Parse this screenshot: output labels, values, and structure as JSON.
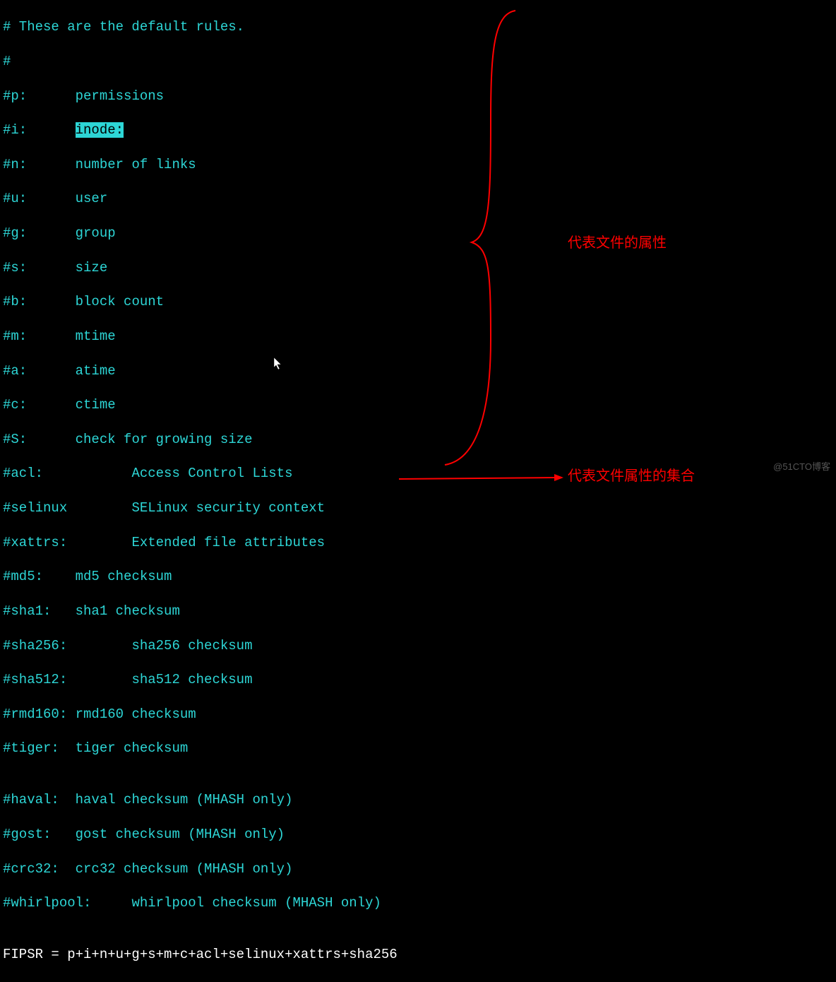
{
  "terminal": {
    "lines": [
      {
        "text": "# These are the default rules."
      },
      {
        "text": "#"
      },
      {
        "prefix": "#p:      ",
        "value": "permissions"
      },
      {
        "prefix": "#i:      ",
        "highlight": "inode:"
      },
      {
        "prefix": "#n:      ",
        "value": "number of links"
      },
      {
        "prefix": "#u:      ",
        "value": "user"
      },
      {
        "prefix": "#g:      ",
        "value": "group"
      },
      {
        "prefix": "#s:      ",
        "value": "size"
      },
      {
        "prefix": "#b:      ",
        "value": "block count"
      },
      {
        "prefix": "#m:      ",
        "value": "mtime"
      },
      {
        "prefix": "#a:      ",
        "value": "atime"
      },
      {
        "prefix": "#c:      ",
        "value": "ctime"
      },
      {
        "prefix": "#S:      ",
        "value": "check for growing size"
      },
      {
        "prefix": "#acl:           ",
        "value": "Access Control Lists"
      },
      {
        "prefix": "#selinux        ",
        "value": "SELinux security context"
      },
      {
        "prefix": "#xattrs:        ",
        "value": "Extended file attributes"
      },
      {
        "prefix": "#md5:    ",
        "value": "md5 checksum"
      },
      {
        "prefix": "#sha1:   ",
        "value": "sha1 checksum"
      },
      {
        "prefix": "#sha256:        ",
        "value": "sha256 checksum"
      },
      {
        "prefix": "#sha512:        ",
        "value": "sha512 checksum"
      },
      {
        "prefix": "#rmd160: ",
        "value": "rmd160 checksum"
      },
      {
        "prefix": "#tiger:  ",
        "value": "tiger checksum"
      },
      {
        "text": ""
      },
      {
        "prefix": "#haval:  ",
        "value": "haval checksum (MHASH only)"
      },
      {
        "prefix": "#gost:   ",
        "value": "gost checksum (MHASH only)"
      },
      {
        "prefix": "#crc32:  ",
        "value": "crc32 checksum (MHASH only)"
      },
      {
        "prefix": "#whirlpool:     ",
        "value": "whirlpool checksum (MHASH only)"
      },
      {
        "text": ""
      }
    ],
    "formula": "FIPSR = p+i+n+u+g+s+m+c+acl+selinux+xattrs+sha256"
  },
  "annotations": {
    "attrs": "代表文件的属性",
    "set": "代表文件属性的集合"
  },
  "watermark": "@51CTO博客"
}
